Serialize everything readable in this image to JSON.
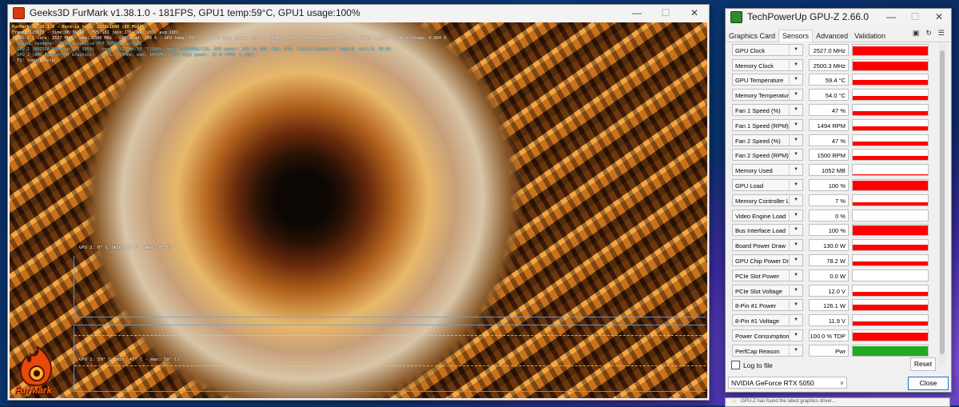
{
  "furmark": {
    "title": "Geeks3D FurMark v1.38.1.0 - 181FPS, GPU1 temp:59°C, GPU1 usage:100%",
    "osd": [
      {
        "text": "FurMark v1.38.1.0 - Burn-in test, 1920x1080 (0X MSAA)",
        "color": "y"
      },
      {
        "text": "Frames:125073 - time:08:36:46 - FPS:181 (min:176, max:187, avg:180)",
        "color": "w"
      },
      {
        "text": "[ GPU-Z ] core: 2527 MHz - mem: 2500 MHz - GPU load: 100 % - GPU temp: 59 ° C - GPU chip power: 78.2 W (PPW: 2.314) - Board power: 130.8 W (PPW: 1.392) - GPU voltage: 0.860 V",
        "color": "w"
      },
      {
        "text": "- OpenGL renderer: NVIDIA GeForce RTX 5050/PCIe/SSE2",
        "color": "c"
      },
      {
        "text": "- GPU 1 (NVIDIA GeForce RTX 5050) - core: 2527MHz/59 °C/100%, mem: 10001MHz/12%, GPU power: 100.1% TDP, fan: 47%, limits:[power:1, temp:0, volt:0, OV:0]",
        "color": "c"
      },
      {
        "text": "- GPU 2 (AMD Radeon(TM) Graphics) - core: 600MHz, mem: 3000MHz, GPU chip power: 33 W (PPW: 5.485)",
        "color": "c"
      },
      {
        "text": "- F1: toggle help",
        "color": "w"
      }
    ],
    "graph1_label": "GPU 2: 0° C (min: 0° C - max: 0° C)",
    "graph2_label": "GPU 1: 59° C (min: 45° C - max: 59° C)",
    "logo_text": "FurMark"
  },
  "gpuz": {
    "title": "TechPowerUp GPU-Z 2.66.0",
    "tabs": [
      "Graphics Card",
      "Sensors",
      "Advanced",
      "Validation"
    ],
    "active_tab": "Sensors",
    "sensors": [
      {
        "label": "GPU Clock",
        "value": "2527.0 MHz",
        "fill": 0.88,
        "color": "#ff0000"
      },
      {
        "label": "Memory Clock",
        "value": "2500.3 MHz",
        "fill": 0.88,
        "color": "#ff0000"
      },
      {
        "label": "GPU Temperature",
        "value": "59.4 °C",
        "fill": 0.5,
        "color": "#ff0000"
      },
      {
        "label": "Memory Temperature",
        "value": "54.0 °C",
        "fill": 0.45,
        "color": "#ff0000"
      },
      {
        "label": "Fan 1 Speed (%)",
        "value": "47 %",
        "fill": 0.45,
        "color": "#ff0000"
      },
      {
        "label": "Fan 1 Speed (RPM)",
        "value": "1494 RPM",
        "fill": 0.45,
        "color": "#ff0000"
      },
      {
        "label": "Fan 2 Speed (%)",
        "value": "47 %",
        "fill": 0.45,
        "color": "#ff0000"
      },
      {
        "label": "Fan 2 Speed (RPM)",
        "value": "1500 RPM",
        "fill": 0.45,
        "color": "#ff0000"
      },
      {
        "label": "Memory Used",
        "value": "1052 MB",
        "fill": 0.12,
        "color": "#ff0000"
      },
      {
        "label": "GPU Load",
        "value": "100 %",
        "fill": 1.0,
        "color": "#ff0000"
      },
      {
        "label": "Memory Controller Load",
        "value": "7 %",
        "fill": 0.3,
        "color": "#ff0000"
      },
      {
        "label": "Video Engine Load",
        "value": "0 %",
        "fill": 0.0,
        "color": "#ff0000"
      },
      {
        "label": "Bus Interface Load",
        "value": "100 %",
        "fill": 1.0,
        "color": "#ff0000"
      },
      {
        "label": "Board Power Draw",
        "value": "130.0 W",
        "fill": 0.6,
        "color": "#ff0000"
      },
      {
        "label": "GPU Chip Power Draw",
        "value": "78.2 W",
        "fill": 0.45,
        "color": "#ff0000"
      },
      {
        "label": "PCIe Slot Power",
        "value": "0.0 W",
        "fill": 0.0,
        "color": "#ff0000"
      },
      {
        "label": "PCIe Slot Voltage",
        "value": "12.0 V",
        "fill": 0.45,
        "color": "#ff0000"
      },
      {
        "label": "8-Pin #1 Power",
        "value": "126.1 W",
        "fill": 0.55,
        "color": "#ff0000"
      },
      {
        "label": "8-Pin #1 Voltage",
        "value": "11.9 V",
        "fill": 0.45,
        "color": "#ff0000"
      },
      {
        "label": "Power Consumption (%)",
        "value": "100.0 % TDP",
        "fill": 0.85,
        "color": "#ff0000"
      },
      {
        "label": "PerfCap Reason",
        "value": "Pwr",
        "fill": 1.0,
        "color": "#22aa22"
      }
    ],
    "log_to_file": "Log to file",
    "reset": "Reset",
    "device": "NVIDIA GeForce RTX 5050",
    "close": "Close"
  },
  "notification": "GPU-Z has found the latest graphics driver..."
}
